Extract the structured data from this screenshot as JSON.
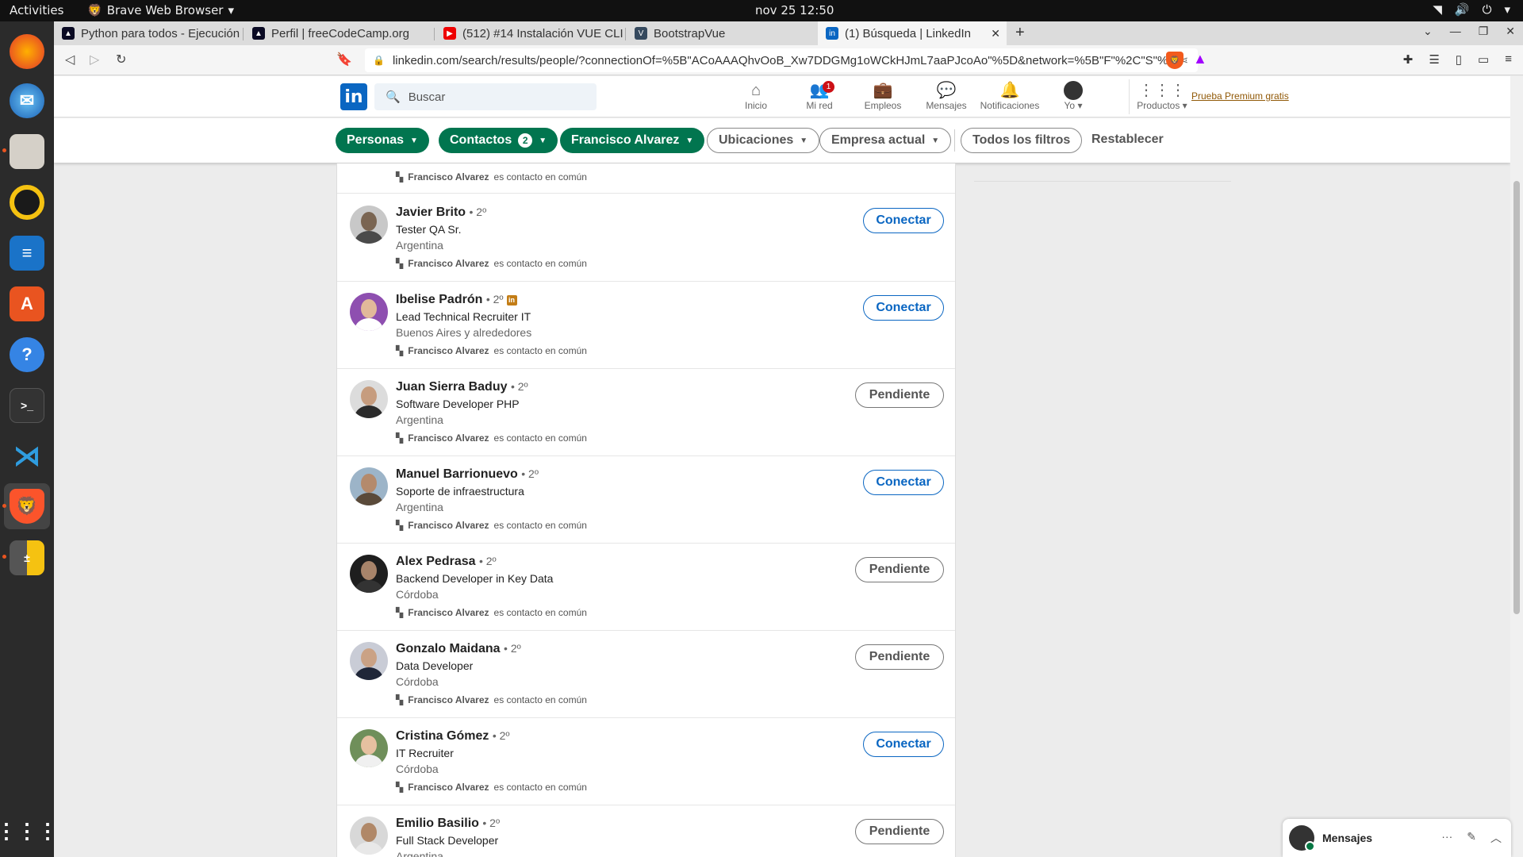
{
  "system": {
    "activities": "Activities",
    "app_name": "Brave Web Browser",
    "clock": "nov 25  12:50"
  },
  "dock": {
    "icons": [
      "firefox-icon",
      "thunderbird-icon",
      "files-icon",
      "rhythmbox-icon",
      "writer-icon",
      "software-icon",
      "help-icon",
      "terminal-icon",
      "vscode-icon",
      "brave-icon",
      "calculator-icon",
      "apps-grid-icon"
    ]
  },
  "browser": {
    "tabs": [
      {
        "label": "Python para todos - Ejecución",
        "favicon": "freecodecamp"
      },
      {
        "label": "Perfil | freeCodeCamp.org",
        "favicon": "freecodecamp"
      },
      {
        "label": "(512) #14 Instalación VUE CLI",
        "favicon": "youtube"
      },
      {
        "label": "BootstrapVue",
        "favicon": "bootstrapvue"
      },
      {
        "label": "(1) Búsqueda | LinkedIn",
        "favicon": "linkedin",
        "active": true
      }
    ],
    "url": "linkedin.com/search/results/people/?connectionOf=%5B\"ACoAAAQhvOoB_Xw7DDGMg1oWCkHJmL7aaPJcoAo\"%5D&network=%5B\"F\"%2C\"S\"%..."
  },
  "linkedin": {
    "search_placeholder": "Buscar",
    "nav": [
      {
        "label": "Inicio",
        "icon": "home-icon"
      },
      {
        "label": "Mi red",
        "icon": "network-icon",
        "badge": "1"
      },
      {
        "label": "Empleos",
        "icon": "briefcase-icon"
      },
      {
        "label": "Mensajes",
        "icon": "messages-icon"
      },
      {
        "label": "Notificaciones",
        "icon": "bell-icon"
      },
      {
        "label": "Yo",
        "icon": "avatar"
      },
      {
        "label": "Productos",
        "icon": "grid-icon"
      }
    ],
    "premium": "Prueba Premium gratis",
    "filters": {
      "personas": "Personas",
      "contactos": "Contactos",
      "contactos_count": "2",
      "francisco": "Francisco Alvarez",
      "ubicaciones": "Ubicaciones",
      "empresa": "Empresa actual",
      "todos": "Todos los filtros",
      "reset": "Restablecer"
    },
    "mutual_name": "Francisco Alvarez",
    "mutual_suffix": "es contacto en común",
    "degree": "• 2º",
    "results": [
      {
        "name": "Javier Brito",
        "title": "Tester QA Sr.",
        "location": "Argentina",
        "action": "Conectar"
      },
      {
        "name": "Ibelise Padrón",
        "title": "Lead Technical Recruiter IT",
        "location": "Buenos Aires y alrededores",
        "action": "Conectar",
        "premium": true
      },
      {
        "name": "Juan Sierra Baduy",
        "title": "Software Developer PHP",
        "location": "Argentina",
        "action": "Pendiente"
      },
      {
        "name": "Manuel Barrionuevo",
        "title": "Soporte de infraestructura",
        "location": "Argentina",
        "action": "Conectar"
      },
      {
        "name": "Alex Pedrasa",
        "title": "Backend Developer in Key Data",
        "location": "Córdoba",
        "action": "Pendiente"
      },
      {
        "name": "Gonzalo Maidana",
        "title": "Data Developer",
        "location": "Córdoba",
        "action": "Pendiente"
      },
      {
        "name": "Cristina Gómez",
        "title": "IT Recruiter",
        "location": "Córdoba",
        "action": "Conectar"
      },
      {
        "name": "Emilio Basilio",
        "title": "Full Stack Developer",
        "location": "Argentina",
        "action": "Pendiente"
      }
    ],
    "messaging_label": "Mensajes"
  },
  "colors": {
    "linkedin_blue": "#0a66c2",
    "filter_green": "#01754f",
    "premium_gold": "#915907"
  }
}
